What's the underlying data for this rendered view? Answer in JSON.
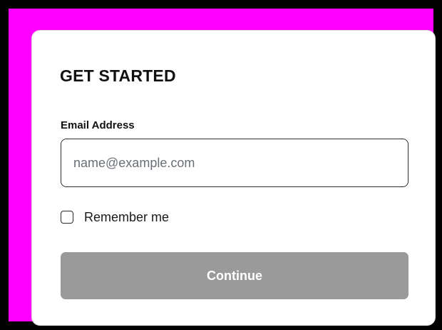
{
  "form": {
    "title": "GET STARTED",
    "email": {
      "label": "Email Address",
      "value": "",
      "placeholder": "name@example.com"
    },
    "remember": {
      "label": "Remember me",
      "checked": false
    },
    "continue_label": "Continue"
  },
  "colors": {
    "frame": "#ff00ff",
    "card_background": "#ffffff",
    "button_disabled": "#9a9a9a",
    "text": "#111111"
  }
}
